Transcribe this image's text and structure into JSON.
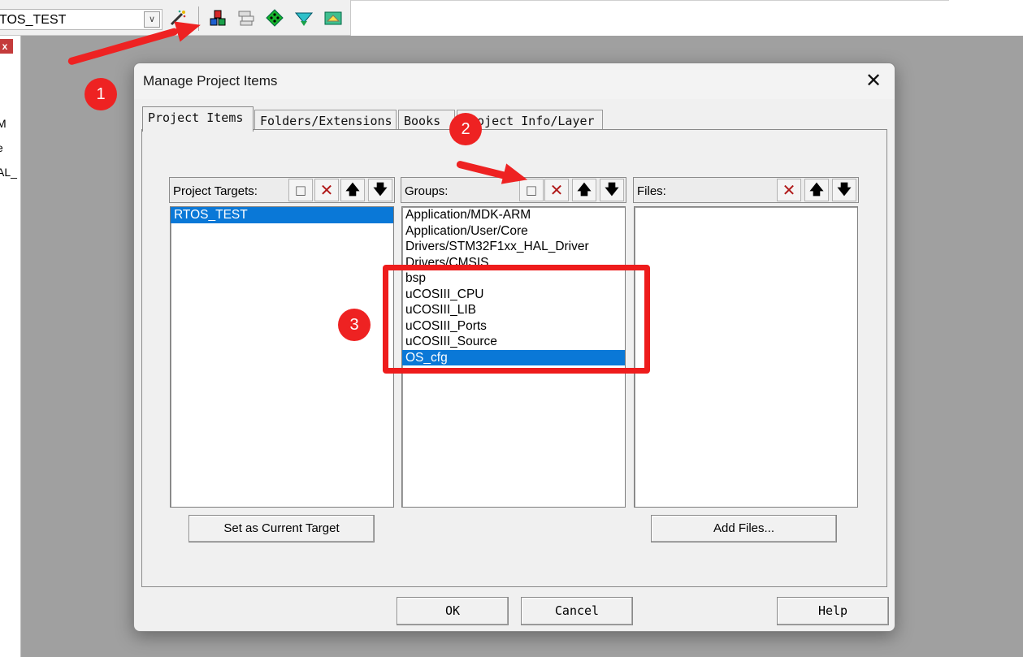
{
  "ide": {
    "target_name": "TOS_TEST",
    "left_fragments": [
      "M",
      "e",
      "AL_"
    ],
    "close_glyph": "x",
    "toolbar_icons": [
      "wand-icon",
      "load-icon",
      "build-icon",
      "rebuild-icon",
      "batch-icon",
      "translate-icon"
    ]
  },
  "dialog": {
    "title": "Manage Project Items",
    "tabs": [
      "Project Items",
      "Folders/Extensions",
      "Books",
      "Project Info/Layer"
    ],
    "project_targets": {
      "label": "Project Targets:",
      "items": [
        "RTOS_TEST"
      ],
      "selected_index": 0
    },
    "groups": {
      "label": "Groups:",
      "items": [
        "Application/MDK-ARM",
        "Application/User/Core",
        "Drivers/STM32F1xx_HAL_Driver",
        "Drivers/CMSIS",
        "bsp",
        "uCOSIII_CPU",
        "uCOSIII_LIB",
        "uCOSIII_Ports",
        "uCOSIII_Source",
        "OS_cfg"
      ],
      "selected_index": 9
    },
    "files": {
      "label": "Files:",
      "items": []
    },
    "buttons": {
      "set_current_target": "Set as Current Target",
      "add_files": "Add Files...",
      "ok": "OK",
      "cancel": "Cancel",
      "help": "Help"
    }
  },
  "annotations": {
    "badges": [
      "1",
      "2",
      "3"
    ],
    "accent_color": "#ee2222"
  }
}
